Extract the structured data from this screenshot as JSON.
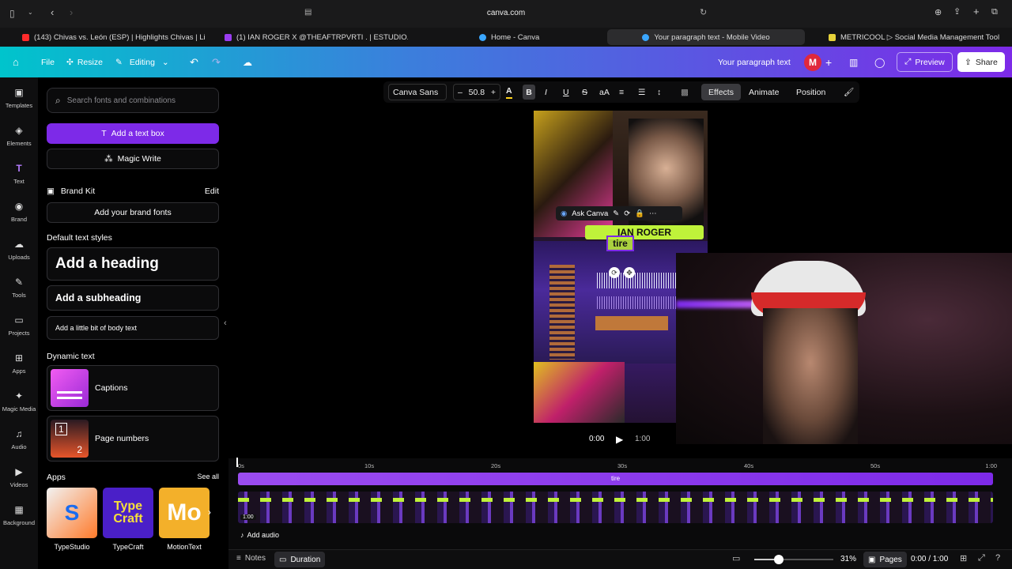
{
  "browser": {
    "url": "canva.com",
    "tabs": [
      {
        "label": "(143) Chivas vs. León (ESP) | Highlights Chivas | Li...",
        "color": "#ff2b2b"
      },
      {
        "label": "(1) IAN ROGER X @THEAFTRPVRTI  . | ESTUDIO...",
        "color": "#9a3df0"
      },
      {
        "label": "Home - Canva",
        "color": "#3aa6ff"
      },
      {
        "label": "Your paragraph text - Mobile Video",
        "color": "#3aa6ff"
      },
      {
        "label": "METRICOOL ▷ Social Media Management Tool",
        "color": "#e6d23a"
      }
    ]
  },
  "topbar": {
    "file": "File",
    "resize": "Resize",
    "editing": "Editing",
    "doc_title": "Your paragraph text",
    "avatar": "M",
    "preview": "Preview",
    "share": "Share"
  },
  "rail": [
    {
      "label": "Templates",
      "icon": "templates-icon",
      "glyph": "▣"
    },
    {
      "label": "Elements",
      "icon": "elements-icon",
      "glyph": "◈"
    },
    {
      "label": "Text",
      "icon": "text-icon",
      "glyph": "T"
    },
    {
      "label": "Brand",
      "icon": "brand-icon",
      "glyph": "◉"
    },
    {
      "label": "Uploads",
      "icon": "uploads-icon",
      "glyph": "☁"
    },
    {
      "label": "Tools",
      "icon": "tools-icon",
      "glyph": "✎"
    },
    {
      "label": "Projects",
      "icon": "projects-icon",
      "glyph": "▭"
    },
    {
      "label": "Apps",
      "icon": "apps-icon",
      "glyph": "⊞"
    },
    {
      "label": "Magic Media",
      "icon": "magic-media-icon",
      "glyph": "✦"
    },
    {
      "label": "Audio",
      "icon": "audio-icon",
      "glyph": "♫"
    },
    {
      "label": "Videos",
      "icon": "videos-icon",
      "glyph": "▶"
    },
    {
      "label": "Background",
      "icon": "background-icon",
      "glyph": "▦"
    }
  ],
  "panel": {
    "search_placeholder": "Search fonts and combinations",
    "add_text_box": "Add a text box",
    "magic_write": "Magic Write",
    "brand_kit": "Brand Kit",
    "brand_edit": "Edit",
    "add_brand_fonts": "Add your brand fonts",
    "default_styles": "Default text styles",
    "heading": "Add a heading",
    "subheading": "Add a subheading",
    "body": "Add a little bit of body text",
    "dynamic_text": "Dynamic text",
    "captions": "Captions",
    "page_numbers": "Page numbers",
    "apps": "Apps",
    "see_all": "See all",
    "app_list": [
      "TypeStudio",
      "TypeCraft",
      "MotionText"
    ]
  },
  "toolbar": {
    "font": "Canva Sans",
    "size": "50.8",
    "effects": "Effects",
    "animate": "Animate",
    "position": "Position"
  },
  "canvas": {
    "ask_canva": "Ask Canva",
    "overlay_name": "IAN ROGER",
    "overlay_word": "tire"
  },
  "player": {
    "current": "0:00",
    "total": "1:00"
  },
  "timeline": {
    "ticks": [
      "0s",
      "10s",
      "20s",
      "30s",
      "40s",
      "50s",
      "1:00"
    ],
    "text_track": "tire",
    "clip_duration": "1:00",
    "add_audio": "Add audio"
  },
  "bottombar": {
    "notes": "Notes",
    "duration": "Duration",
    "zoom": "31%",
    "zoom_fraction": 0.31,
    "pages": "Pages",
    "time": "0:00 / 1:00"
  },
  "colors": {
    "accent": "#7d2ae8",
    "teal": "#00c4cc"
  }
}
